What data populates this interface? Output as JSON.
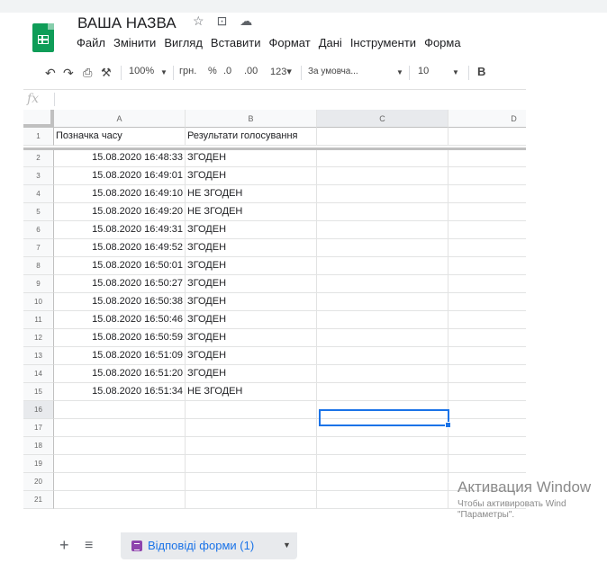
{
  "doc": {
    "title": "ВАША НАЗВА"
  },
  "menu": [
    "Файл",
    "Змінити",
    "Вигляд",
    "Вставити",
    "Формат",
    "Дані",
    "Інструменти",
    "Форма"
  ],
  "toolbar": {
    "zoom": "100%",
    "currency": "грн.",
    "percent": "%",
    "dec_less": ".0",
    "dec_more": ".00",
    "format_more": "123▾",
    "font": "За умовча...",
    "font_size": "10",
    "bold": "B"
  },
  "formula_bar": {
    "fx": "fx",
    "value": ""
  },
  "columns": [
    "A",
    "B",
    "C",
    "D"
  ],
  "header_row": [
    "Позначка часу",
    "Результати голосування"
  ],
  "rows": [
    [
      "15.08.2020 16:48:33",
      "ЗГОДЕН"
    ],
    [
      "15.08.2020 16:49:01",
      "ЗГОДЕН"
    ],
    [
      "15.08.2020 16:49:10",
      "НЕ ЗГОДЕН"
    ],
    [
      "15.08.2020 16:49:20",
      "НЕ ЗГОДЕН"
    ],
    [
      "15.08.2020 16:49:31",
      "ЗГОДЕН"
    ],
    [
      "15.08.2020 16:49:52",
      "ЗГОДЕН"
    ],
    [
      "15.08.2020 16:50:01",
      "ЗГОДЕН"
    ],
    [
      "15.08.2020 16:50:27",
      "ЗГОДЕН"
    ],
    [
      "15.08.2020 16:50:38",
      "ЗГОДЕН"
    ],
    [
      "15.08.2020 16:50:46",
      "ЗГОДЕН"
    ],
    [
      "15.08.2020 16:50:59",
      "ЗГОДЕН"
    ],
    [
      "15.08.2020 16:51:09",
      "ЗГОДЕН"
    ],
    [
      "15.08.2020 16:51:20",
      "ЗГОДЕН"
    ],
    [
      "15.08.2020 16:51:34",
      "НЕ ЗГОДЕН"
    ]
  ],
  "row_numbers": [
    "1",
    "2",
    "3",
    "4",
    "5",
    "6",
    "7",
    "8",
    "9",
    "10",
    "11",
    "12",
    "13",
    "14",
    "15",
    "16",
    "17",
    "18",
    "19",
    "20",
    "21"
  ],
  "sheet_tab": {
    "label": "Відповіді форми (1)"
  },
  "watermark": {
    "line1": "Активация Window",
    "line2": "Чтобы активировать Wind",
    "line3": "\"Параметры\"."
  }
}
